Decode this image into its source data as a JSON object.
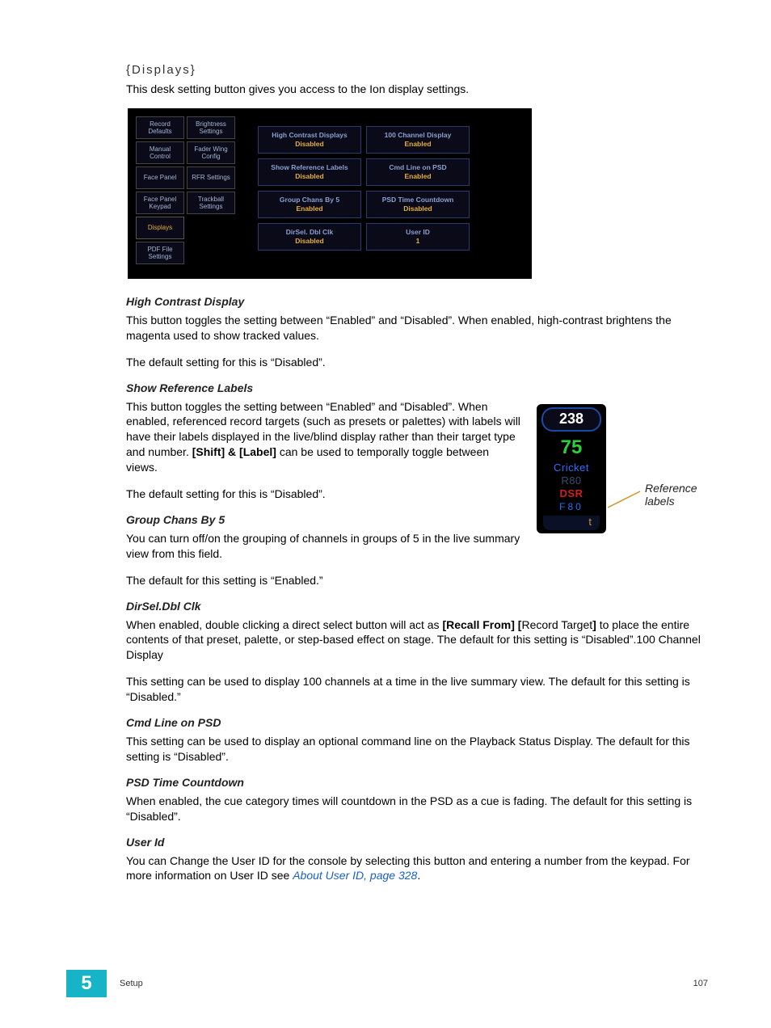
{
  "heading": "{Displays}",
  "intro": "This desk setting button gives you access to the Ion display settings.",
  "ui_panel": {
    "tabs": [
      {
        "label": "Record Defaults"
      },
      {
        "label": "Brightness Settings"
      },
      {
        "label": "Manual Control"
      },
      {
        "label": "Fader Wing Config"
      },
      {
        "label": "Face Panel"
      },
      {
        "label": "RFR Settings"
      },
      {
        "label": "Face Panel Keypad"
      },
      {
        "label": "Trackball Settings"
      },
      {
        "label": "Displays",
        "active": true,
        "span2": true
      },
      {
        "label": "PDF File Settings",
        "span2": true
      }
    ],
    "options": [
      {
        "label": "High Contrast Displays",
        "value": "Disabled"
      },
      {
        "label": "100 Channel Display",
        "value": "Enabled"
      },
      {
        "label": "Show Reference Labels",
        "value": "Disabled"
      },
      {
        "label": "Cmd Line on PSD",
        "value": "Enabled"
      },
      {
        "label": "Group Chans By 5",
        "value": "Enabled"
      },
      {
        "label": "PSD Time Countdown",
        "value": "Disabled"
      },
      {
        "label": "DirSel. Dbl Clk",
        "value": "Disabled"
      },
      {
        "label": "User ID",
        "value": "1"
      }
    ]
  },
  "sections": {
    "hcd": {
      "title": "High Contrast Display",
      "p1": "This button toggles the setting between “Enabled” and “Disabled”. When enabled, high-contrast brightens the magenta used to show tracked values.",
      "p2": "The default setting for this is “Disabled”."
    },
    "srl": {
      "title": "Show Reference Labels",
      "p1a": "This button toggles the setting between “Enabled” and “Disabled”. When enabled, referenced record targets (such as presets or palettes) with labels will have their labels displayed in the live/blind display rather than their target type and number. ",
      "p1b": "[Shift] & [Label]",
      "p1c": " can be used to temporally toggle between views.",
      "p2": "The default setting for this is “Disabled”."
    },
    "gcb5": {
      "title": "Group Chans By 5",
      "p1": "You can turn off/on the grouping of channels in groups of 5 in the live summary view from this field.",
      "p2": "The default for this setting is “Enabled.”"
    },
    "dsdc": {
      "title": "DirSel.Dbl Clk",
      "p1a": "When enabled, double clicking a direct select button will act as ",
      "p1b": "[Recall From] [",
      "p1c": "Record Target",
      "p1d": "]",
      "p1e": " to place the entire contents of that preset, palette, or step-based effect on stage. The default for this setting is “Disabled”.100 Channel Display",
      "p2": "This setting can be used to display 100 channels at a time in the live summary view. The default for this setting is “Disabled.”"
    },
    "clp": {
      "title": "Cmd Line on PSD",
      "p1": "This setting can be used to display an optional command line on the Playback Status Display. The default for this setting is “Disabled”."
    },
    "ptc": {
      "title": "PSD Time Countdown",
      "p1": "When enabled, the cue category times will countdown in the PSD as a cue is fading. The default for this setting is “Disabled”."
    },
    "uid": {
      "title": "User Id",
      "p1a": "You can Change the User ID for the console by selecting this button and entering a number from the keypad. For more information on User ID see ",
      "link": "About User ID, page 328",
      "p1b": "."
    }
  },
  "figure": {
    "channel": "238",
    "level": "75",
    "labels": {
      "cricket": "Cricket",
      "r80": "R80",
      "dsr": "DSR",
      "f80": "F80"
    },
    "callout": "Reference labels"
  },
  "footer": {
    "chapter": "5",
    "section": "Setup",
    "page": "107"
  }
}
